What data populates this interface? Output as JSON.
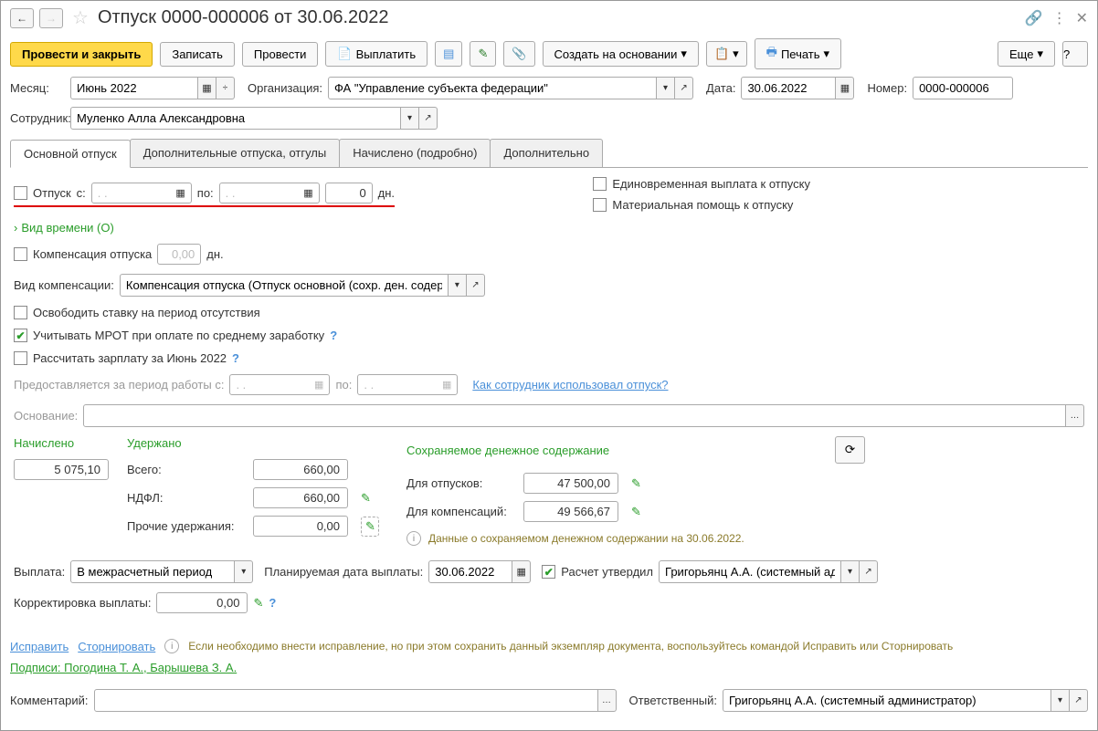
{
  "title": "Отпуск 0000-000006 от 30.06.2022",
  "toolbar": {
    "post_close": "Провести и закрыть",
    "save": "Записать",
    "post": "Провести",
    "pay": "Выплатить",
    "create_based": "Создать на основании",
    "print": "Печать",
    "more": "Еще"
  },
  "fields": {
    "month_label": "Месяц:",
    "month_value": "Июнь 2022",
    "org_label": "Организация:",
    "org_value": "ФА \"Управление субъекта федерации\"",
    "date_label": "Дата:",
    "date_value": "30.06.2022",
    "number_label": "Номер:",
    "number_value": "0000-000006",
    "employee_label": "Сотрудник:",
    "employee_value": "Муленко Алла Александровна"
  },
  "tabs": {
    "main": "Основной отпуск",
    "additional": "Дополнительные отпуска, отгулы",
    "accrued": "Начислено (подробно)",
    "extra": "Дополнительно"
  },
  "main_tab": {
    "vacation_label": "Отпуск",
    "from": "с:",
    "to": "по:",
    "date_placeholder": ". .",
    "days_value": "0",
    "days_unit": "дн.",
    "lump_sum": "Единовременная выплата к отпуску",
    "mat_help": "Материальная помощь к отпуску",
    "time_type": "Вид времени (О)",
    "compensation_label": "Компенсация отпуска",
    "comp_value": "0,00",
    "comp_type_label": "Вид компенсации:",
    "comp_type_value": "Компенсация отпуска (Отпуск основной (сохр. ден. содерж",
    "release_rate": "Освободить ставку на период отсутствия",
    "mrot": "Учитывать МРОТ при оплате по среднему заработку",
    "calc_salary": "Рассчитать зарплату за Июнь 2022",
    "period_label": "Предоставляется за период работы с:",
    "period_to": "по:",
    "usage_link": "Как сотрудник использовал отпуск?",
    "basis_label": "Основание:"
  },
  "totals": {
    "accrued_hdr": "Начислено",
    "accrued_val": "5 075,10",
    "withheld_hdr": "Удержано",
    "total_label": "Всего:",
    "total_val": "660,00",
    "ndfl_label": "НДФЛ:",
    "ndfl_val": "660,00",
    "other_label": "Прочие удержания:",
    "other_val": "0,00",
    "saved_hdr": "Сохраняемое денежное содержание",
    "for_vac": "Для отпусков:",
    "for_vac_val": "47 500,00",
    "for_comp": "Для компенсаций:",
    "for_comp_val": "49 566,67",
    "info_text": "Данные о сохраняемом денежном содержании на 30.06.2022."
  },
  "payment": {
    "pay_label": "Выплата:",
    "pay_value": "В межрасчетный период",
    "plan_date_label": "Планируемая дата выплаты:",
    "plan_date_value": "30.06.2022",
    "approved_label": "Расчет утвердил",
    "approved_value": "Григорьянц А.А. (системный адми",
    "correction_label": "Корректировка выплаты:",
    "correction_value": "0,00"
  },
  "footer": {
    "fix_link": "Исправить",
    "reverse_link": "Сторнировать",
    "fix_text": "Если необходимо внести исправление, но при этом сохранить данный экземпляр документа, воспользуйтесь командой Исправить или Сторнировать",
    "signatures": "Подписи: Погодина Т. А., Барышева З. А.",
    "comment_label": "Комментарий:",
    "responsible_label": "Ответственный:",
    "responsible_value": "Григорьянц А.А. (системный администратор)"
  }
}
